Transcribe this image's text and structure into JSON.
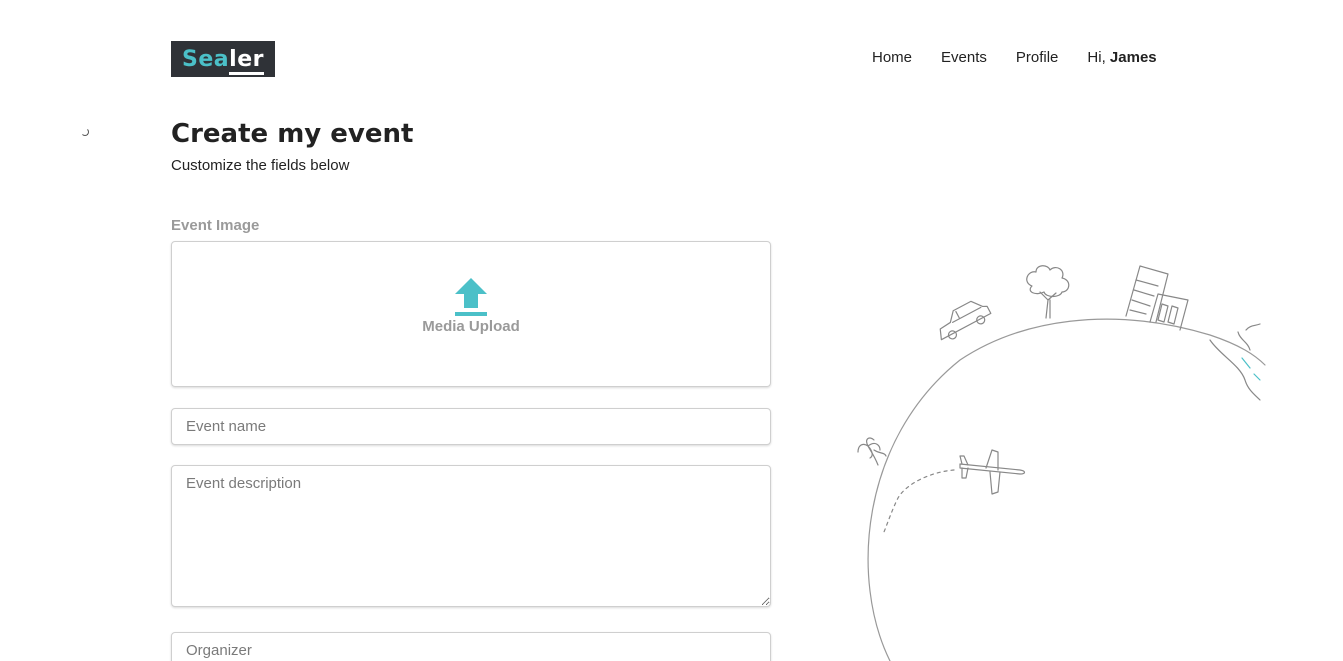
{
  "header": {
    "logo": {
      "part1": "Sea",
      "part2": "ler"
    },
    "nav": {
      "home": "Home",
      "events": "Events",
      "profile": "Profile",
      "greeting": "Hi,",
      "user_name": "James"
    }
  },
  "main": {
    "title": "Create my event",
    "subtitle": "Customize the fields below",
    "image_label": "Event Image",
    "upload_label": "Media Upload",
    "event_name_placeholder": "Event name",
    "event_description_placeholder": "Event description",
    "organizer_placeholder": "Organizer"
  },
  "colors": {
    "accent": "#4bc0c8",
    "logo_bg": "#2f3237",
    "label_gray": "#9a9a9a"
  },
  "icons": {
    "upload": "upload-arrow-icon",
    "illustration": "globe-travel-illustration"
  }
}
